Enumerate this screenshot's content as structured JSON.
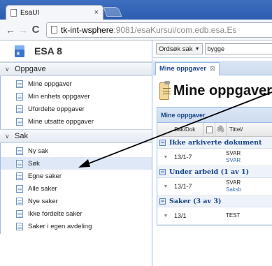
{
  "browser": {
    "tab_title": "EsaUI",
    "tab_close": "×",
    "url_host": "tk-int-wsphere",
    "url_rest": ":9081/esaKursui/com.edb.esa.Es",
    "back_icon": "back-arrow-icon",
    "forward_icon": "forward-arrow-icon",
    "reload_icon": "reload-icon",
    "accent": "#2c5cae"
  },
  "sidebar": {
    "brand": {
      "logo_text": "8",
      "name": "ESA 8"
    },
    "groups": [
      {
        "title": "Oppgave",
        "items": [
          {
            "label": "Mine oppgaver"
          },
          {
            "label": "Min enhets oppgaver"
          },
          {
            "label": "Ufordelte oppgaver"
          },
          {
            "label": "Mine utsatte oppgaver"
          }
        ]
      },
      {
        "title": "Sak",
        "items": [
          {
            "label": "Ny sak"
          },
          {
            "label": "Søk",
            "selected": true
          },
          {
            "label": "Egne saker"
          },
          {
            "label": "Alle saker"
          },
          {
            "label": "Nye saker"
          },
          {
            "label": "Ikke fordelte saker"
          },
          {
            "label": "Saker i egen avdeling"
          }
        ]
      }
    ]
  },
  "main": {
    "search": {
      "type_label": "Ordsøk sak",
      "query": "bygge"
    },
    "tab": {
      "label": "Mine oppgaver",
      "close": "⊠"
    },
    "title": "Mine oppgaver",
    "grid": {
      "panel_title": "Mine oppgaver",
      "columns": {
        "sakdok": "Sak/Dok",
        "title": "Tittel/"
      },
      "groups": [
        {
          "label": "Ikke arkiverte dokument",
          "rows": [
            {
              "sakdok": "13/1-7",
              "line1": "SVAR",
              "line2": "SVAR"
            }
          ]
        },
        {
          "label": "Under arbeid (1 av 1)",
          "rows": [
            {
              "sakdok": "13/1-7",
              "line1": "SVAR",
              "line2": "Saksb"
            }
          ]
        },
        {
          "label": "Saker (3 av 3)",
          "rows": [
            {
              "sakdok": "13/1",
              "line1": "TEST",
              "line2": ""
            }
          ]
        }
      ]
    }
  },
  "colors": {
    "panel_border": "#99bbe8",
    "header_text": "#15428b",
    "selected_bg": "#dfe8f6"
  }
}
